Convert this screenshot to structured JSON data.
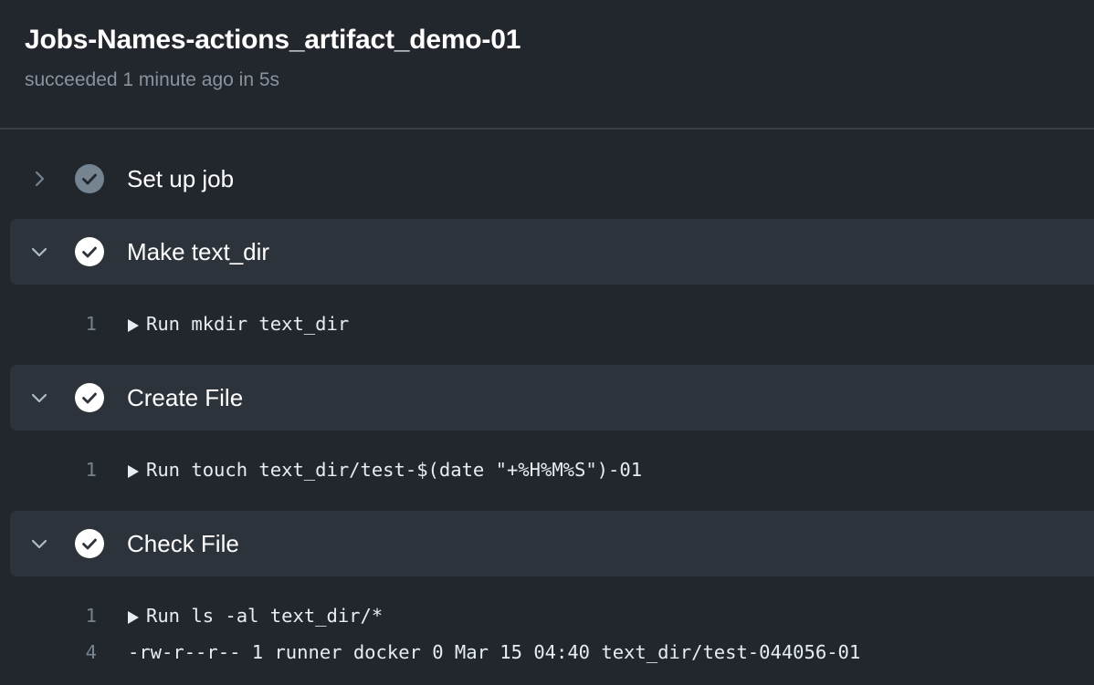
{
  "header": {
    "title": "Jobs-Names-actions_artifact_demo-01",
    "status": "succeeded 1 minute ago in 5s"
  },
  "colors": {
    "background": "#22272e",
    "step_header_bg": "#2d333b",
    "success_check_active": "#ffffff",
    "success_check_collapsed": "#768390"
  },
  "steps": [
    {
      "name": "Set up job",
      "expanded": false,
      "icon": "check-circle-icon",
      "lines": []
    },
    {
      "name": "Make text_dir",
      "expanded": true,
      "icon": "check-circle-icon",
      "lines": [
        {
          "number": "1",
          "text": "Run mkdir text_dir",
          "collapsible": true
        }
      ]
    },
    {
      "name": "Create File",
      "expanded": true,
      "icon": "check-circle-icon",
      "lines": [
        {
          "number": "1",
          "text": "Run touch text_dir/test-$(date \"+%H%M%S\")-01",
          "collapsible": true
        }
      ]
    },
    {
      "name": "Check File",
      "expanded": true,
      "icon": "check-circle-icon",
      "lines": [
        {
          "number": "1",
          "text": "Run ls -al text_dir/*",
          "collapsible": true
        },
        {
          "number": "4",
          "text": "-rw-r--r-- 1 runner docker 0 Mar 15 04:40 text_dir/test-044056-01",
          "collapsible": false
        }
      ]
    }
  ]
}
